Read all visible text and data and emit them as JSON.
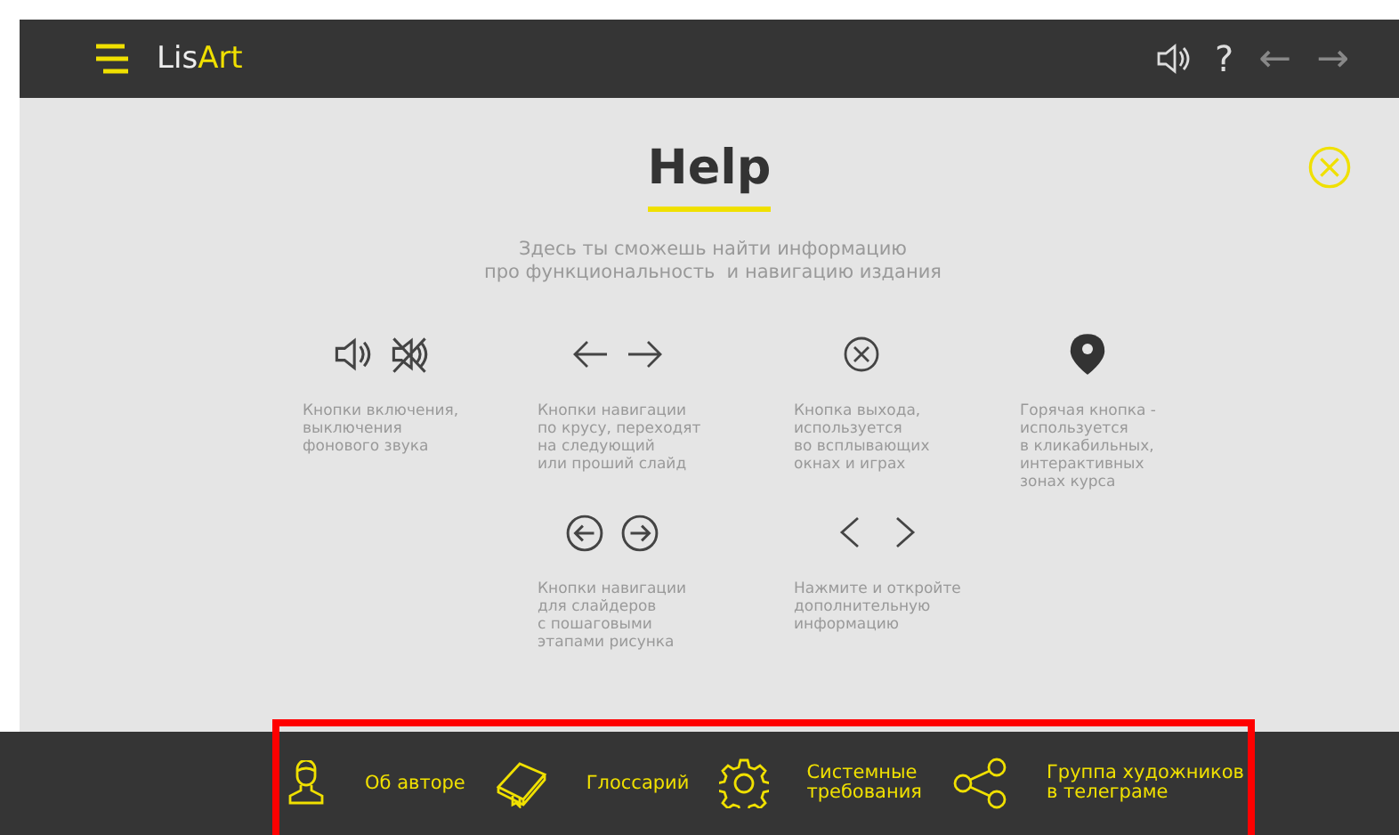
{
  "header": {
    "logo": [
      "Lis",
      "Art"
    ],
    "help_button": "?",
    "back_button": "←",
    "forward_button": "→"
  },
  "help": {
    "title": "Help",
    "subtitle": "Здесь ты сможешь найти информацию\nпро функциональность  и навигацию издания",
    "items": [
      {
        "kind": "sound",
        "text": "Кнопки включения,\nвыключения\nфонового звука"
      },
      {
        "kind": "arrows",
        "text": "Кнопки навигации\nпо крусу, переходят\nна следующий\nили проший слайд"
      },
      {
        "kind": "close",
        "text": "Кнопка выхода,\nиспользуется\nво всплывающих\nокнах и играх"
      },
      {
        "kind": "pin",
        "text": "Горячая кнопка -\nиспользуется\nв кликабильных,\nинтерактивных\nзонах курса"
      },
      {
        "kind": "circle-arrows",
        "text": "Кнопки навигации\nдля слайдеров\nс пошаговыми\nэтапами рисунка"
      },
      {
        "kind": "chevrons",
        "text": "Нажмите и откройте\nдополнительную\nинформацию"
      }
    ]
  },
  "footer": {
    "items": [
      {
        "kind": "person",
        "label": "Об авторе"
      },
      {
        "kind": "book",
        "label": "Глоссарий"
      },
      {
        "kind": "gear",
        "label": "Системные\nтребования"
      },
      {
        "kind": "share",
        "label": "Группа художников\nв телеграме"
      }
    ]
  }
}
